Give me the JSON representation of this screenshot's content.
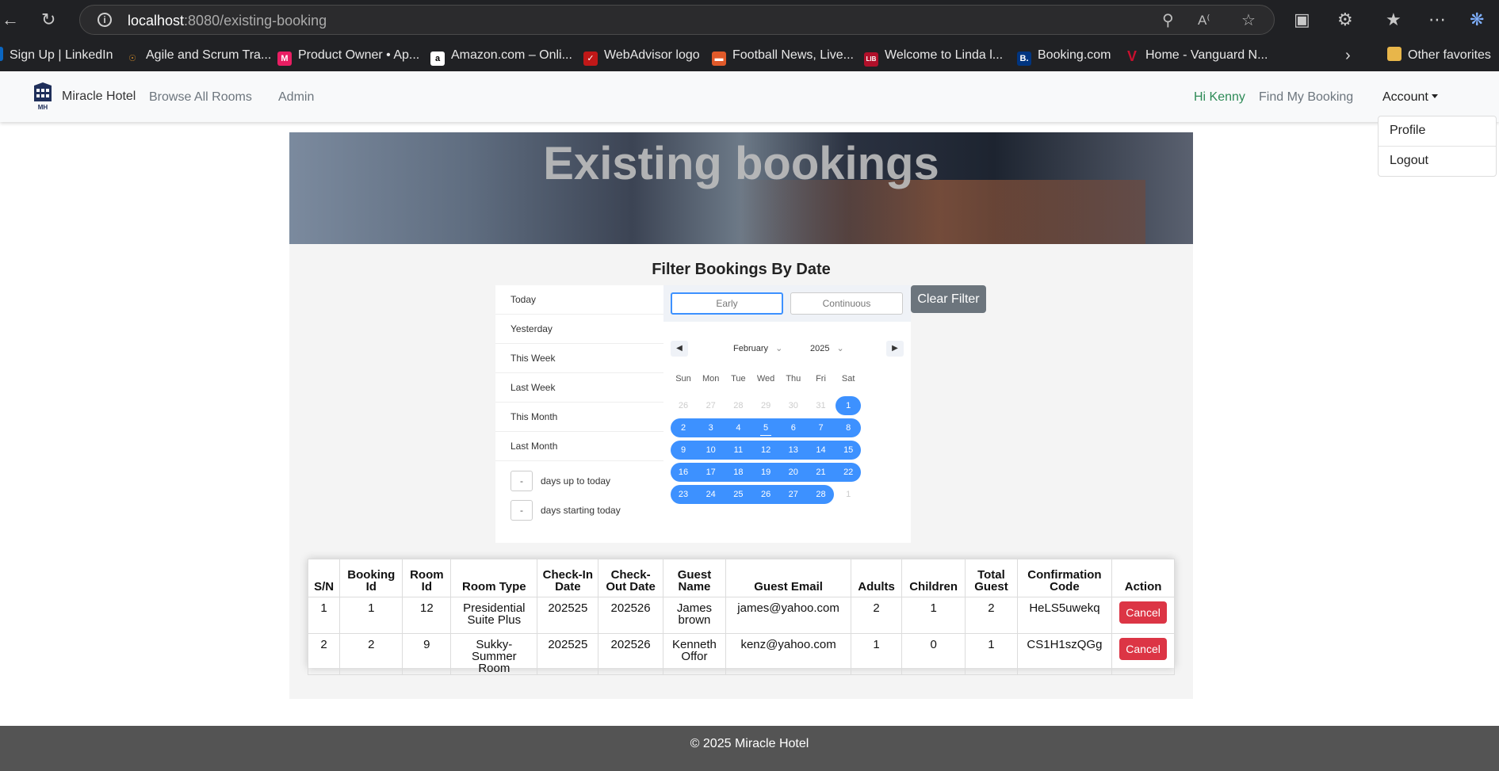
{
  "browser": {
    "url_host": "localhost",
    "url_rest": ":8080/existing-booking",
    "bookmarks": [
      {
        "label": "Sign Up | LinkedIn",
        "color": "#0a66c2"
      },
      {
        "label": "Agile and Scrum Tra...",
        "color": "#c8862a"
      },
      {
        "label": "Product Owner • Ap...",
        "color": "#e91e63"
      },
      {
        "label": "Amazon.com – Onli...",
        "color": "#ffffff"
      },
      {
        "label": "WebAdvisor logo",
        "color": "#c01818"
      },
      {
        "label": "Football News, Live...",
        "color": "#e05a2a"
      },
      {
        "label": "Welcome to Linda l...",
        "color": "#b0102a"
      },
      {
        "label": "Booking.com",
        "color": "#003580"
      },
      {
        "label": "Home - Vanguard N...",
        "color": "#c8102e"
      }
    ],
    "other_favorites": "Other favorites"
  },
  "navbar": {
    "brand": "Miracle Hotel",
    "browse": "Browse All Rooms",
    "admin": "Admin",
    "greeting": "Hi Kenny",
    "find_booking": "Find My Booking",
    "account": "Account",
    "menu": {
      "profile": "Profile",
      "logout": "Logout"
    }
  },
  "banner": {
    "title": "Existing bookings"
  },
  "filter": {
    "title": "Filter Bookings By Date",
    "ranges": [
      "Today",
      "Yesterday",
      "This Week",
      "Last Week",
      "This Month",
      "Last Month"
    ],
    "days_up": "days up to today",
    "days_start": "days starting today",
    "days_value": "-",
    "mode_early": "Early",
    "mode_continuous": "Continuous",
    "month": "February",
    "year": "2025",
    "weekdays": [
      "Sun",
      "Mon",
      "Tue",
      "Wed",
      "Thu",
      "Fri",
      "Sat"
    ],
    "weeks": [
      [
        "26",
        "27",
        "28",
        "29",
        "30",
        "31",
        "1"
      ],
      [
        "2",
        "3",
        "4",
        "5",
        "6",
        "7",
        "8"
      ],
      [
        "9",
        "10",
        "11",
        "12",
        "13",
        "14",
        "15"
      ],
      [
        "16",
        "17",
        "18",
        "19",
        "20",
        "21",
        "22"
      ],
      [
        "23",
        "24",
        "25",
        "26",
        "27",
        "28",
        "1"
      ]
    ],
    "clear": "Clear Filter"
  },
  "table": {
    "headers": [
      "S/N",
      "Booking Id",
      "Room Id",
      "Room Type",
      "Check-In Date",
      "Check-Out Date",
      "Guest Name",
      "Guest Email",
      "Adults",
      "Children",
      "Total Guest",
      "Confirmation Code",
      "Action"
    ],
    "rows": [
      [
        "1",
        "1",
        "12",
        "Presidential Suite Plus",
        "202525",
        "202526",
        "James brown",
        "james@yahoo.com",
        "2",
        "1",
        "2",
        "HeLS5uwekq",
        "Cancel"
      ],
      [
        "2",
        "2",
        "9",
        "Sukky-Summer Room",
        "202525",
        "202526",
        "Kenneth Offor",
        "kenz@yahoo.com",
        "1",
        "0",
        "1",
        "CS1H1szQGg",
        "Cancel"
      ]
    ]
  },
  "footer": "© 2025 Miracle Hotel"
}
